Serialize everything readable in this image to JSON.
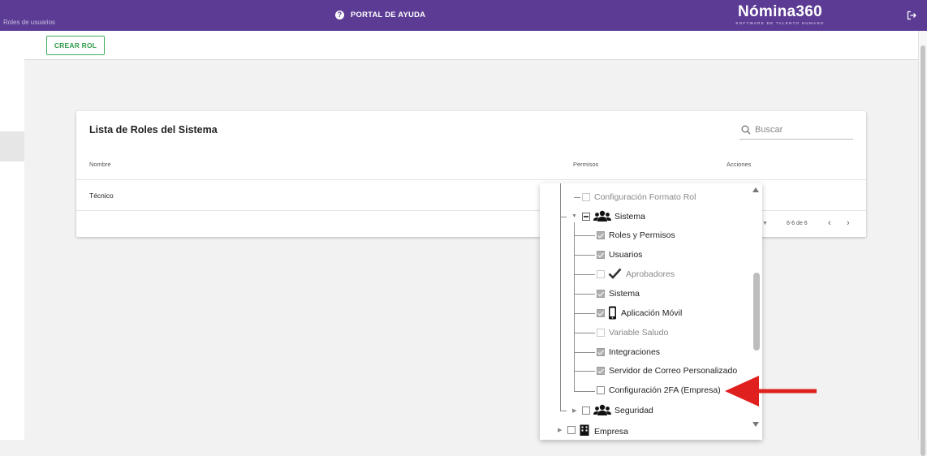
{
  "header": {
    "breadcrumb": "Roles de usuarios",
    "help_label": "PORTAL DE AYUDA",
    "logo_name": "Nómina360",
    "logo_tagline": "SOFTWARE DE TALENTO HUMANO",
    "brand_color": "#5b3b94"
  },
  "toolbar": {
    "create_role_label": "CREAR ROL",
    "create_role_color": "#3fae5a"
  },
  "card": {
    "title": "Lista de Roles del Sistema",
    "search_placeholder": "Buscar",
    "columns": [
      "Nombre",
      "Permisos",
      "Acciones"
    ],
    "rows": [
      {
        "nombre": "Técnico"
      }
    ],
    "pagination": "6-6 de 6"
  },
  "permissions_tree": {
    "items": [
      {
        "label": "Configuración Formato Rol",
        "state": "unchecked-faded",
        "level": 1
      },
      {
        "label": "Sistema",
        "state": "partial",
        "level": 0,
        "icon": "users-icon",
        "expanded": true
      },
      {
        "label": "Roles y Permisos",
        "state": "checked",
        "level": 1
      },
      {
        "label": "Usuarios",
        "state": "checked",
        "level": 1
      },
      {
        "label": "Aprobadores",
        "state": "unchecked-faded",
        "level": 1,
        "icon": "check-icon"
      },
      {
        "label": "Sistema",
        "state": "checked",
        "level": 1
      },
      {
        "label": "Aplicación Móvil",
        "state": "checked",
        "level": 1,
        "icon": "mobile-icon"
      },
      {
        "label": "Variable Saludo",
        "state": "unchecked-faded",
        "level": 1
      },
      {
        "label": "Integraciones",
        "state": "checked",
        "level": 1
      },
      {
        "label": "Servidor de Correo Personalizado",
        "state": "checked",
        "level": 1
      },
      {
        "label": "Configuración 2FA (Empresa)",
        "state": "unchecked",
        "level": 1
      },
      {
        "label": "Seguridad",
        "state": "unchecked",
        "level": 0,
        "icon": "users-icon",
        "expanded": false
      },
      {
        "label": "Empresa",
        "state": "unchecked",
        "level": 0,
        "icon": "building-icon",
        "expanded": false
      }
    ]
  },
  "annotation": {
    "arrow_color": "#e01f1f"
  }
}
